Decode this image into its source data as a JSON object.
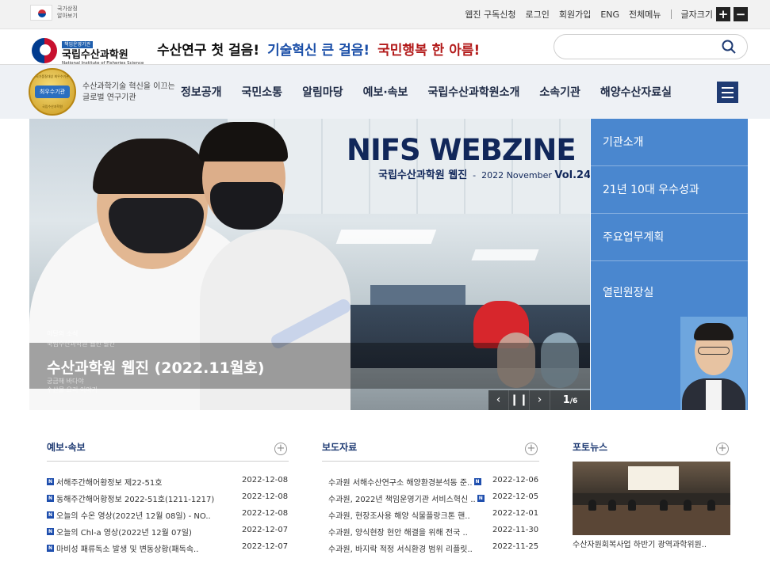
{
  "gov_banner": {
    "line1": "국가상징",
    "line2": "알아보기"
  },
  "util_links": [
    "웹진 구독신청",
    "로그인",
    "회원가입",
    "ENG",
    "전체메뉴"
  ],
  "font_size": {
    "label": "글자크기",
    "plus": "+",
    "minus": "−"
  },
  "logo": {
    "badge": "책임운영기관",
    "name": "국립수산과학원",
    "en": "National Institute of Fisheries Science"
  },
  "slogan": {
    "part1": "수산연구 첫 걸음!",
    "part2": "기술혁신 큰 걸음!",
    "part3": "국민행복 한 아름!"
  },
  "search": {
    "placeholder": "",
    "icon": "search-icon"
  },
  "medal": {
    "rim_top": "국가품질대상 최우수기관",
    "center": "최우수기관",
    "rim_bottom": "국립수산과학원"
  },
  "tagline": "수산과학기술 혁신을 이끄는 글로벌 연구기관",
  "gnb": [
    "정보공개",
    "국민소통",
    "알림마당",
    "예보·속보",
    "국립수산과학원소개",
    "소속기관",
    "해양수산자료실"
  ],
  "hero": {
    "webzine_title": "NIFS WEBZINE",
    "webzine_sub_ko": "국립수산과학원 웹진",
    "webzine_sub_date": "2022 November",
    "webzine_sub_vol": "Vol.24",
    "small1": "이달의 소식",
    "small2": "국립수산과학원 웹진 발간",
    "title": "수산과학원 웹진 (2022.11월호)",
    "small3": "궁금해 바다야",
    "small4": "수산물 요리 이야기",
    "prev": "‹",
    "pause": "❙❙",
    "next": "›",
    "page_current": "1",
    "page_total": "/6"
  },
  "quick_menu": [
    "기관소개",
    "21년 10대 우수성과",
    "주요업무계획",
    "열린원장실"
  ],
  "forecast": {
    "title": "예보·속보",
    "plus": "+",
    "items": [
      {
        "title": "서해주간해어황정보 제22-51호",
        "date": "2022-12-08"
      },
      {
        "title": "동해주간해어황정보 2022-51호(1211-1217)",
        "date": "2022-12-08"
      },
      {
        "title": "오늘의 수온 영상(2022년 12월 08일) - NO..",
        "date": "2022-12-08"
      },
      {
        "title": "오늘의 Chl-a 영상(2022년 12월 07일)",
        "date": "2022-12-07"
      },
      {
        "title": "마비성 패류독소 발생 및 변동상황(패독속..",
        "date": "2022-12-07"
      }
    ]
  },
  "press": {
    "title": "보도자료",
    "plus": "+",
    "items": [
      {
        "title": "수과원 서해수산연구소 해양환경분석동 준..",
        "date": "2022-12-06",
        "new": true
      },
      {
        "title": "수과원, 2022년 책임운영기관 서비스혁신 ..",
        "date": "2022-12-05",
        "new": true
      },
      {
        "title": "수과원, 현장조사용 해양 식물플랑크톤 핸..",
        "date": "2022-12-01",
        "new": false
      },
      {
        "title": "수과원, 양식현장 현안 해결을 위해 전국 ..",
        "date": "2022-11-30",
        "new": false
      },
      {
        "title": "수과원, 바지락 적정 서식환경 범위 리플릿..",
        "date": "2022-11-25",
        "new": false
      }
    ]
  },
  "photo_news": {
    "title": "포토뉴스",
    "plus": "+",
    "caption": "수산자원회복사업 하반기 광역과학위원.."
  },
  "new_badge": "N",
  "colors": {
    "accent": "#1f3b73",
    "quick_bg": "#4a87cf",
    "slogan_blue": "#1b4fa8",
    "slogan_red": "#b31b1b"
  }
}
